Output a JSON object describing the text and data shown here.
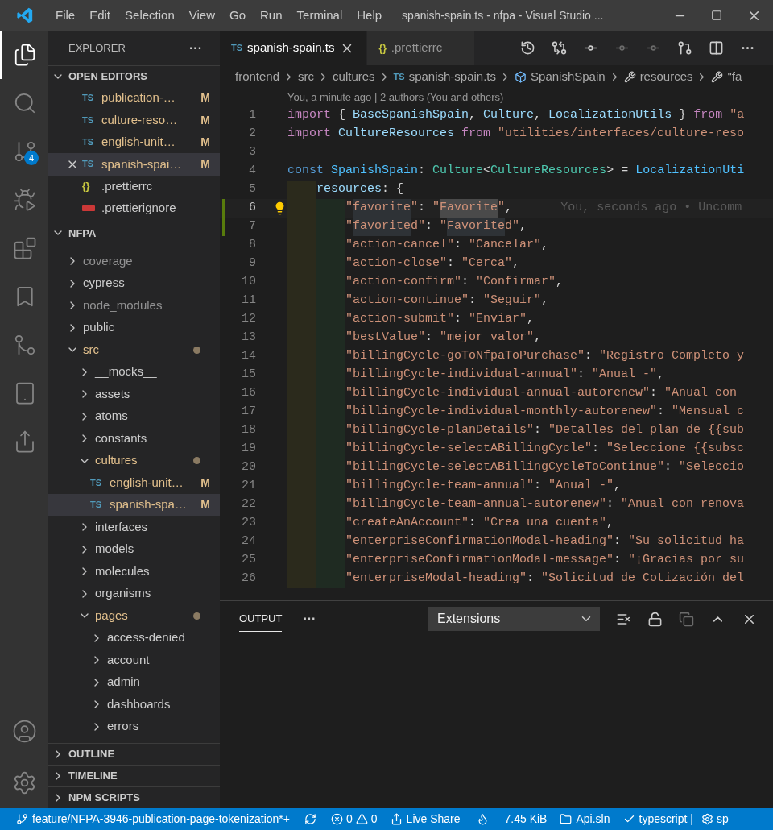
{
  "window": {
    "menu": [
      "File",
      "Edit",
      "Selection",
      "View",
      "Go",
      "Run",
      "Terminal",
      "Help"
    ],
    "title": "spanish-spain.ts - nfpa - Visual Studio ..."
  },
  "activity_bar": {
    "items": [
      {
        "kind": "files",
        "selected": true
      },
      {
        "kind": "search",
        "selected": false
      },
      {
        "kind": "source-control",
        "selected": false,
        "badge": "4"
      },
      {
        "kind": "debug",
        "selected": false
      },
      {
        "kind": "extensions",
        "selected": false
      },
      {
        "kind": "bookmark",
        "selected": false
      },
      {
        "kind": "git-graph",
        "selected": false
      },
      {
        "kind": "remote",
        "selected": false
      },
      {
        "kind": "live-share",
        "selected": false
      }
    ],
    "bottom": [
      {
        "kind": "account"
      },
      {
        "kind": "settings"
      }
    ]
  },
  "sidebar": {
    "title": "EXPLORER",
    "more": "···",
    "open_editors": {
      "title": "OPEN EDITORS",
      "expanded": true,
      "items": [
        {
          "kind": "ts",
          "icon_text": "TS",
          "name": "publication-…",
          "badge": "M",
          "selected": false
        },
        {
          "kind": "ts",
          "icon_text": "TS",
          "name": "culture-reso…",
          "badge": "M",
          "selected": false
        },
        {
          "kind": "ts",
          "icon_text": "TS",
          "name": "english-unit…",
          "badge": "M",
          "selected": false
        },
        {
          "kind": "ts",
          "icon_text": "TS",
          "name": "spanish-spai…",
          "badge": "M",
          "selected": true
        },
        {
          "kind": "json",
          "icon_text": "{}",
          "name": ".prettierrc",
          "selected": false
        },
        {
          "kind": "ignore",
          "name": ".prettierignore",
          "selected": false
        }
      ]
    },
    "folder": {
      "title": "NFPA",
      "expanded": true,
      "children": [
        {
          "kind": "folder",
          "name": "coverage",
          "expanded": false,
          "modified": false,
          "ignored": true
        },
        {
          "kind": "folder",
          "name": "cypress",
          "expanded": false,
          "modified": false,
          "ignored": false
        },
        {
          "kind": "folder",
          "name": "node_modules",
          "expanded": false,
          "modified": false,
          "ignored": true
        },
        {
          "kind": "folder",
          "name": "public",
          "expanded": false,
          "modified": false,
          "ignored": false
        },
        {
          "kind": "folder",
          "name": "src",
          "expanded": true,
          "modified": true,
          "ignored": false,
          "children": [
            {
              "kind": "folder",
              "name": "__mocks__",
              "expanded": false,
              "modified": false,
              "ignored": false
            },
            {
              "kind": "folder",
              "name": "assets",
              "expanded": false,
              "modified": false,
              "ignored": false
            },
            {
              "kind": "folder",
              "name": "atoms",
              "expanded": false,
              "modified": false,
              "ignored": false
            },
            {
              "kind": "folder",
              "name": "constants",
              "expanded": false,
              "modified": false,
              "ignored": false
            },
            {
              "kind": "folder",
              "name": "cultures",
              "expanded": true,
              "modified": true,
              "ignored": false,
              "children": [
                {
                  "kind": "file",
                  "icon_text": "TS",
                  "name": "english-unit…",
                  "badge": "M",
                  "modified": true,
                  "ignored": false,
                  "selected": false
                },
                {
                  "kind": "file",
                  "icon_text": "TS",
                  "name": "spanish-spa…",
                  "badge": "M",
                  "modified": true,
                  "ignored": false,
                  "selected": true
                }
              ]
            },
            {
              "kind": "folder",
              "name": "interfaces",
              "expanded": false,
              "modified": false,
              "ignored": false
            },
            {
              "kind": "folder",
              "name": "models",
              "expanded": false,
              "modified": false,
              "ignored": false
            },
            {
              "kind": "folder",
              "name": "molecules",
              "expanded": false,
              "modified": false,
              "ignored": false
            },
            {
              "kind": "folder",
              "name": "organisms",
              "expanded": false,
              "modified": false,
              "ignored": false
            },
            {
              "kind": "folder",
              "name": "pages",
              "expanded": true,
              "modified": true,
              "ignored": false,
              "children": [
                {
                  "kind": "folder",
                  "name": "access-denied",
                  "expanded": false,
                  "modified": false,
                  "ignored": false
                },
                {
                  "kind": "folder",
                  "name": "account",
                  "expanded": false,
                  "modified": false,
                  "ignored": false
                },
                {
                  "kind": "folder",
                  "name": "admin",
                  "expanded": false,
                  "modified": false,
                  "ignored": false
                },
                {
                  "kind": "folder",
                  "name": "dashboards",
                  "expanded": false,
                  "modified": false,
                  "ignored": false
                },
                {
                  "kind": "folder",
                  "name": "errors",
                  "expanded": false,
                  "modified": false,
                  "ignored": false
                }
              ]
            }
          ]
        }
      ]
    },
    "sections": [
      {
        "title": "OUTLINE",
        "expanded": false
      },
      {
        "title": "TIMELINE",
        "expanded": false
      },
      {
        "title": "NPM SCRIPTS",
        "expanded": false
      }
    ]
  },
  "tabs": [
    {
      "icon_text": "TS",
      "kind": "ts",
      "label": "spanish-spain.ts",
      "selected": true
    },
    {
      "icon_text": "{}",
      "kind": "json",
      "label": ".prettierrc",
      "selected": false
    }
  ],
  "breadcrumb": [
    {
      "label": "frontend",
      "kind": "folder"
    },
    {
      "label": "src",
      "kind": "folder"
    },
    {
      "label": "cultures",
      "kind": "folder"
    },
    {
      "label": "spanish-spain.ts",
      "kind": "ts",
      "icon_text": "TS"
    },
    {
      "label": "SpanishSpain",
      "kind": "symbol"
    },
    {
      "label": "resources",
      "kind": "property"
    },
    {
      "label": "\"fa",
      "kind": "property"
    }
  ],
  "codelens": "You, a minute ago | 2 authors (You and others)",
  "lines": [
    {
      "n": "1",
      "current": false,
      "changed": false,
      "tokens": [
        {
          "t": "import",
          "kind": "keyword"
        },
        {
          "t": " { ",
          "kind": "punct"
        },
        {
          "t": "BaseSpanishSpain",
          "kind": "var"
        },
        {
          "t": ", ",
          "kind": "punct"
        },
        {
          "t": "Culture",
          "kind": "var"
        },
        {
          "t": ", ",
          "kind": "punct"
        },
        {
          "t": "LocalizationUtils",
          "kind": "var"
        },
        {
          "t": " } ",
          "kind": "punct"
        },
        {
          "t": "from ",
          "kind": "keyword"
        },
        {
          "t": "\"a",
          "kind": "string"
        }
      ]
    },
    {
      "n": "2",
      "current": false,
      "changed": false,
      "tokens": [
        {
          "t": "import ",
          "kind": "keyword"
        },
        {
          "t": "CultureResources ",
          "kind": "var"
        },
        {
          "t": "from ",
          "kind": "keyword"
        },
        {
          "t": "\"utilities/interfaces/culture-reso",
          "kind": "string"
        }
      ]
    },
    {
      "n": "3",
      "current": false,
      "changed": false
    },
    {
      "n": "4",
      "current": false,
      "changed": false,
      "tokens": [
        {
          "t": "const ",
          "kind": "storage"
        },
        {
          "t": "SpanishSpain",
          "kind": "constant"
        },
        {
          "t": ": ",
          "kind": "punct"
        },
        {
          "t": "Culture",
          "kind": "type"
        },
        {
          "t": "<",
          "kind": "punct"
        },
        {
          "t": "CultureResources",
          "kind": "type"
        },
        {
          "t": "> = ",
          "kind": "punct"
        },
        {
          "t": "LocalizationUti",
          "kind": "constant"
        }
      ],
      "children": [
        {
          "n": "5",
          "current": false,
          "changed": false,
          "tokens": [
            {
              "t": "resources",
              "kind": "var"
            },
            {
              "t": ": {",
              "kind": "punct"
            }
          ],
          "children": [
            {
              "n": "6",
              "current": true,
              "changed": true,
              "lightbulb": true,
              "blame": "You, seconds ago • Uncomm",
              "tokens": [
                {
                  "t": "\"",
                  "kind": "string"
                },
                {
                  "t": "favorite",
                  "kind": "string",
                  "highlight": true
                },
                {
                  "t": "\"",
                  "kind": "string"
                },
                {
                  "t": ": ",
                  "kind": "punct"
                },
                {
                  "t": "\"",
                  "kind": "string"
                },
                {
                  "t": "Favorite",
                  "kind": "string",
                  "highlight": true,
                  "focus": true
                },
                {
                  "t": "\"",
                  "kind": "string"
                },
                {
                  "t": ",",
                  "kind": "punct"
                }
              ]
            },
            {
              "n": "7",
              "current": false,
              "changed": true,
              "tokens": [
                {
                  "t": "\"",
                  "kind": "string"
                },
                {
                  "t": "favorite",
                  "kind": "string",
                  "highlight": true
                },
                {
                  "t": "d\"",
                  "kind": "string"
                },
                {
                  "t": ": ",
                  "kind": "punct"
                },
                {
                  "t": "\"",
                  "kind": "string"
                },
                {
                  "t": "Favorite",
                  "kind": "string",
                  "highlight": true
                },
                {
                  "t": "d\"",
                  "kind": "string"
                },
                {
                  "t": ",",
                  "kind": "punct"
                }
              ]
            },
            {
              "n": "8",
              "current": false,
              "changed": false,
              "tokens": [
                {
                  "t": "\"action-cancel\"",
                  "kind": "string"
                },
                {
                  "t": ": ",
                  "kind": "punct"
                },
                {
                  "t": "\"Cancelar\"",
                  "kind": "string"
                },
                {
                  "t": ",",
                  "kind": "punct"
                }
              ]
            },
            {
              "n": "9",
              "current": false,
              "changed": false,
              "tokens": [
                {
                  "t": "\"action-close\"",
                  "kind": "string"
                },
                {
                  "t": ": ",
                  "kind": "punct"
                },
                {
                  "t": "\"Cerca\"",
                  "kind": "string"
                },
                {
                  "t": ",",
                  "kind": "punct"
                }
              ]
            },
            {
              "n": "10",
              "current": false,
              "changed": false,
              "tokens": [
                {
                  "t": "\"action-confirm\"",
                  "kind": "string"
                },
                {
                  "t": ": ",
                  "kind": "punct"
                },
                {
                  "t": "\"Confirmar\"",
                  "kind": "string"
                },
                {
                  "t": ",",
                  "kind": "punct"
                }
              ]
            },
            {
              "n": "11",
              "current": false,
              "changed": false,
              "tokens": [
                {
                  "t": "\"action-continue\"",
                  "kind": "string"
                },
                {
                  "t": ": ",
                  "kind": "punct"
                },
                {
                  "t": "\"Seguir\"",
                  "kind": "string"
                },
                {
                  "t": ",",
                  "kind": "punct"
                }
              ]
            },
            {
              "n": "12",
              "current": false,
              "changed": false,
              "tokens": [
                {
                  "t": "\"action-submit\"",
                  "kind": "string"
                },
                {
                  "t": ": ",
                  "kind": "punct"
                },
                {
                  "t": "\"Enviar\"",
                  "kind": "string"
                },
                {
                  "t": ",",
                  "kind": "punct"
                }
              ]
            },
            {
              "n": "13",
              "current": false,
              "changed": false,
              "tokens": [
                {
                  "t": "\"bestValue\"",
                  "kind": "string"
                },
                {
                  "t": ": ",
                  "kind": "punct"
                },
                {
                  "t": "\"mejor valor\"",
                  "kind": "string"
                },
                {
                  "t": ",",
                  "kind": "punct"
                }
              ]
            },
            {
              "n": "14",
              "current": false,
              "changed": false,
              "tokens": [
                {
                  "t": "\"billingCycle-goToNfpaToPurchase\"",
                  "kind": "string"
                },
                {
                  "t": ": ",
                  "kind": "punct"
                },
                {
                  "t": "\"Registro Completo y",
                  "kind": "string"
                }
              ]
            },
            {
              "n": "15",
              "current": false,
              "changed": false,
              "tokens": [
                {
                  "t": "\"billingCycle-individual-annual\"",
                  "kind": "string"
                },
                {
                  "t": ": ",
                  "kind": "punct"
                },
                {
                  "t": "\"Anual -\"",
                  "kind": "string"
                },
                {
                  "t": ",",
                  "kind": "punct"
                }
              ]
            },
            {
              "n": "16",
              "current": false,
              "changed": false,
              "tokens": [
                {
                  "t": "\"billingCycle-individual-annual-autorenew\"",
                  "kind": "string"
                },
                {
                  "t": ": ",
                  "kind": "punct"
                },
                {
                  "t": "\"Anual con",
                  "kind": "string"
                }
              ]
            },
            {
              "n": "17",
              "current": false,
              "changed": false,
              "tokens": [
                {
                  "t": "\"billingCycle-individual-monthly-autorenew\"",
                  "kind": "string"
                },
                {
                  "t": ": ",
                  "kind": "punct"
                },
                {
                  "t": "\"Mensual c",
                  "kind": "string"
                }
              ]
            },
            {
              "n": "18",
              "current": false,
              "changed": false,
              "tokens": [
                {
                  "t": "\"billingCycle-planDetails\"",
                  "kind": "string"
                },
                {
                  "t": ": ",
                  "kind": "punct"
                },
                {
                  "t": "\"Detalles del plan de {{sub",
                  "kind": "string"
                }
              ]
            },
            {
              "n": "19",
              "current": false,
              "changed": false,
              "tokens": [
                {
                  "t": "\"billingCycle-selectABillingCycle\"",
                  "kind": "string"
                },
                {
                  "t": ": ",
                  "kind": "punct"
                },
                {
                  "t": "\"Seleccione {{subsc",
                  "kind": "string"
                }
              ]
            },
            {
              "n": "20",
              "current": false,
              "changed": false,
              "tokens": [
                {
                  "t": "\"billingCycle-selectABillingCycleToContinue\"",
                  "kind": "string"
                },
                {
                  "t": ": ",
                  "kind": "punct"
                },
                {
                  "t": "\"Seleccio",
                  "kind": "string"
                }
              ]
            },
            {
              "n": "21",
              "current": false,
              "changed": false,
              "tokens": [
                {
                  "t": "\"billingCycle-team-annual\"",
                  "kind": "string"
                },
                {
                  "t": ": ",
                  "kind": "punct"
                },
                {
                  "t": "\"Anual -\"",
                  "kind": "string"
                },
                {
                  "t": ",",
                  "kind": "punct"
                }
              ]
            },
            {
              "n": "22",
              "current": false,
              "changed": false,
              "tokens": [
                {
                  "t": "\"billingCycle-team-annual-autorenew\"",
                  "kind": "string"
                },
                {
                  "t": ": ",
                  "kind": "punct"
                },
                {
                  "t": "\"Anual con renova",
                  "kind": "string"
                }
              ]
            },
            {
              "n": "23",
              "current": false,
              "changed": false,
              "tokens": [
                {
                  "t": "\"createAnAccount\"",
                  "kind": "string"
                },
                {
                  "t": ": ",
                  "kind": "punct"
                },
                {
                  "t": "\"Crea una cuenta\"",
                  "kind": "string"
                },
                {
                  "t": ",",
                  "kind": "punct"
                }
              ]
            },
            {
              "n": "24",
              "current": false,
              "changed": false,
              "tokens": [
                {
                  "t": "\"enterpriseConfirmationModal-heading\"",
                  "kind": "string"
                },
                {
                  "t": ": ",
                  "kind": "punct"
                },
                {
                  "t": "\"Su solicitud ha",
                  "kind": "string"
                }
              ]
            },
            {
              "n": "25",
              "current": false,
              "changed": false,
              "tokens": [
                {
                  "t": "\"enterpriseConfirmationModal-message\"",
                  "kind": "string"
                },
                {
                  "t": ": ",
                  "kind": "punct"
                },
                {
                  "t": "\"¡Gracias por su",
                  "kind": "string"
                }
              ]
            },
            {
              "n": "26",
              "current": false,
              "changed": false,
              "tokens": [
                {
                  "t": "\"enterpriseModal-heading\"",
                  "kind": "string"
                },
                {
                  "t": ": ",
                  "kind": "punct"
                },
                {
                  "t": "\"Solicitud de Cotización del",
                  "kind": "string"
                }
              ]
            }
          ]
        }
      ]
    }
  ],
  "panel": {
    "tabs": [
      {
        "label": "OUTPUT",
        "selected": true
      }
    ],
    "more": "···",
    "dropdown": "Extensions"
  },
  "status_bar": {
    "branch": "feature/NFPA-3946-publication-page-tokenization*+",
    "errors": "0",
    "warnings": "0",
    "live_share": "Live Share",
    "size": "7.45 KiB",
    "solution": "Api.sln",
    "language": "typescript |",
    "extra": "sp"
  }
}
